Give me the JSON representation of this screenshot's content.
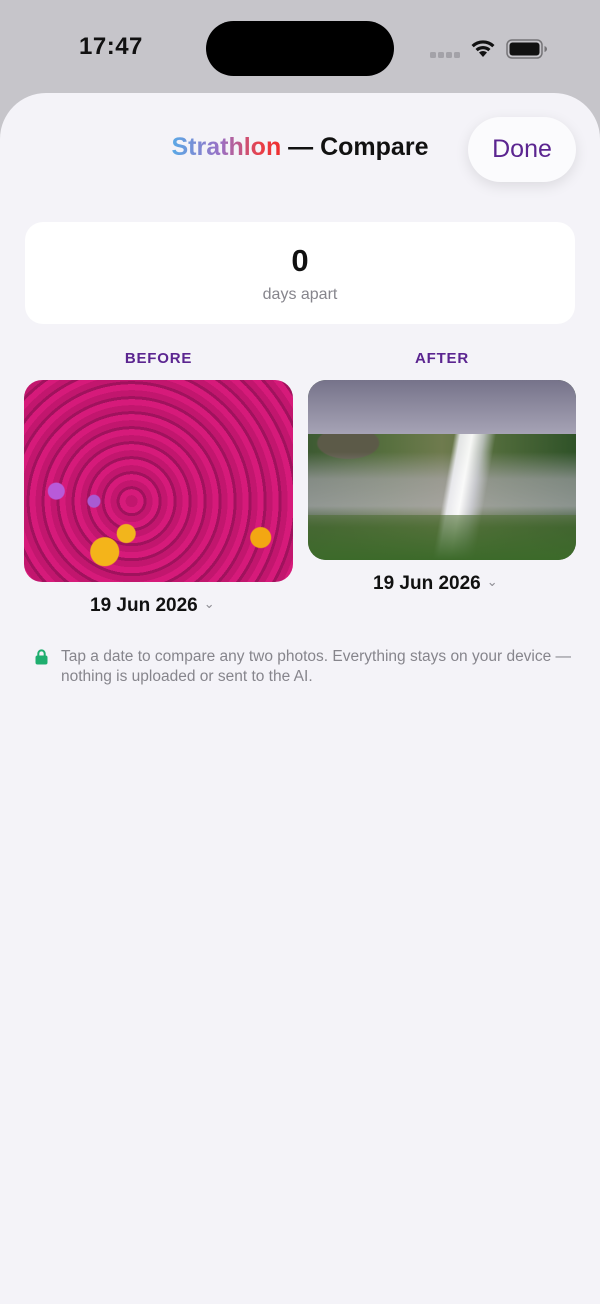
{
  "status_bar": {
    "time": "17:47",
    "icons": [
      "cellular-signal-icon",
      "wifi-icon",
      "battery-icon"
    ]
  },
  "header": {
    "brand": "Strathlon",
    "title_suffix": " — Compare",
    "done_label": "Done"
  },
  "summary": {
    "days_value": "0",
    "days_label": "days apart"
  },
  "before": {
    "label": "BEFORE",
    "date": "19 Jun 2026",
    "photo": "magenta and yellow flowers in a meadow"
  },
  "after": {
    "label": "AFTER",
    "date": "19 Jun 2026",
    "photo": "waterfall in green cliffs"
  },
  "privacy_note": "Tap a date to compare any two photos. Everything stays on your device — nothing is uploaded or sent to the AI.",
  "colors": {
    "accent": "#5b2590",
    "sheet_bg": "#f4f3f8",
    "card_bg": "#ffffff",
    "lock": "#1fae6f",
    "brand_gradient": [
      "#5aa9e6",
      "#9a6fc4",
      "#e8404a"
    ]
  }
}
